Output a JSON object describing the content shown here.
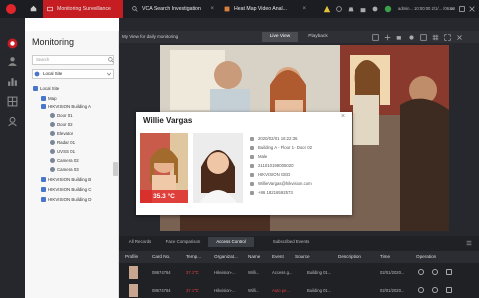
{
  "topbar": {
    "tabs": [
      {
        "label": "Monitoring Surveillance"
      },
      {
        "label": "VCA Search Investigation"
      },
      {
        "label": "Heat Map Video Anal..."
      }
    ],
    "user": "admin... 10:00:00 2/1/... /06:00"
  },
  "sidebar": {
    "title": "Monitoring",
    "search_placeholder": "Search",
    "site": "Local Site",
    "tree": [
      "Local Site",
      "Map",
      "HIKVISION Building A",
      "Door 01",
      "Door 02",
      "Elevator",
      "Radar 01",
      "UVSS 01",
      "Camera 02",
      "Camera 03",
      "HIKVISION Building B",
      "HIKVISION Building C",
      "HIKVISION Building D"
    ]
  },
  "toolbar": {
    "view_name": "My View for daily monitoring",
    "live": "Live View",
    "playback": "Playback"
  },
  "popup": {
    "name": "Willie Vargas",
    "temperature": "35.3 °C",
    "info": [
      "2020/02/01 16:22:36",
      "Building A - Floor 1- Door 02",
      "Male",
      "211010198005020",
      "HIKVISION GED",
      "WillieVargas@hikvision.com",
      "+86 18216592573"
    ]
  },
  "bottom": {
    "tabs": [
      "All Records",
      "Face Comparison",
      "Access Control",
      "Subscribed Events"
    ],
    "columns": [
      "Profile",
      "Card No.",
      "Temp...",
      "Organizat...",
      "Name",
      "Event",
      "Source",
      "Description",
      "Time",
      "Operation"
    ],
    "rows": [
      {
        "card": "08674764",
        "temp": "37.1℃",
        "org": "Hikvision-...",
        "name": "Willi...",
        "event": "Access g...",
        "source": "Building 01...",
        "time": "02/01/2020..."
      },
      {
        "card": "08674764",
        "temp": "37.1℃",
        "org": "Hikvision-...",
        "name": "Willi...",
        "event": "Auto pe...",
        "source": "Building 01...",
        "time": "02/01/2020..."
      }
    ]
  },
  "colors": {
    "accent": "#c51d22",
    "alert": "#e04040"
  }
}
